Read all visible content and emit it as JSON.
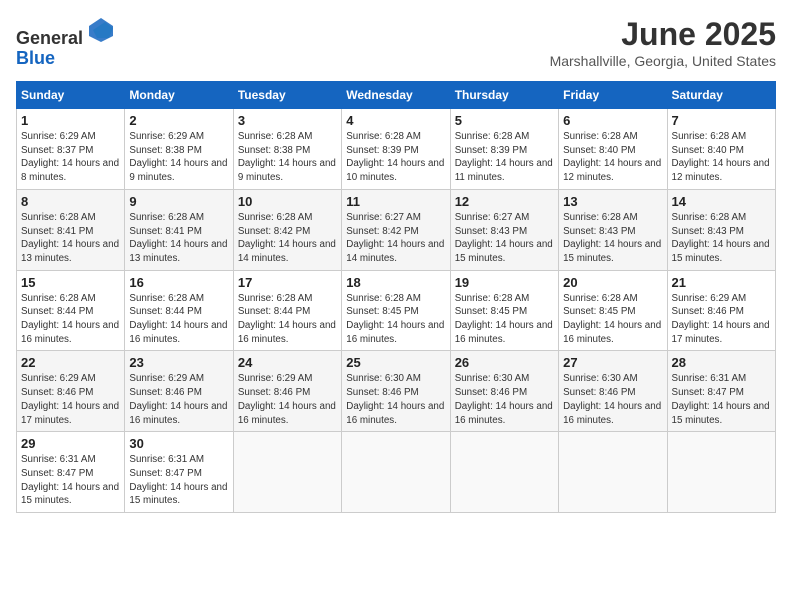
{
  "header": {
    "logo_line1": "General",
    "logo_line2": "Blue",
    "month_title": "June 2025",
    "location": "Marshallville, Georgia, United States"
  },
  "weekdays": [
    "Sunday",
    "Monday",
    "Tuesday",
    "Wednesday",
    "Thursday",
    "Friday",
    "Saturday"
  ],
  "weeks": [
    [
      {
        "day": "1",
        "sunrise": "Sunrise: 6:29 AM",
        "sunset": "Sunset: 8:37 PM",
        "daylight": "Daylight: 14 hours and 8 minutes."
      },
      {
        "day": "2",
        "sunrise": "Sunrise: 6:29 AM",
        "sunset": "Sunset: 8:38 PM",
        "daylight": "Daylight: 14 hours and 9 minutes."
      },
      {
        "day": "3",
        "sunrise": "Sunrise: 6:28 AM",
        "sunset": "Sunset: 8:38 PM",
        "daylight": "Daylight: 14 hours and 9 minutes."
      },
      {
        "day": "4",
        "sunrise": "Sunrise: 6:28 AM",
        "sunset": "Sunset: 8:39 PM",
        "daylight": "Daylight: 14 hours and 10 minutes."
      },
      {
        "day": "5",
        "sunrise": "Sunrise: 6:28 AM",
        "sunset": "Sunset: 8:39 PM",
        "daylight": "Daylight: 14 hours and 11 minutes."
      },
      {
        "day": "6",
        "sunrise": "Sunrise: 6:28 AM",
        "sunset": "Sunset: 8:40 PM",
        "daylight": "Daylight: 14 hours and 12 minutes."
      },
      {
        "day": "7",
        "sunrise": "Sunrise: 6:28 AM",
        "sunset": "Sunset: 8:40 PM",
        "daylight": "Daylight: 14 hours and 12 minutes."
      }
    ],
    [
      {
        "day": "8",
        "sunrise": "Sunrise: 6:28 AM",
        "sunset": "Sunset: 8:41 PM",
        "daylight": "Daylight: 14 hours and 13 minutes."
      },
      {
        "day": "9",
        "sunrise": "Sunrise: 6:28 AM",
        "sunset": "Sunset: 8:41 PM",
        "daylight": "Daylight: 14 hours and 13 minutes."
      },
      {
        "day": "10",
        "sunrise": "Sunrise: 6:28 AM",
        "sunset": "Sunset: 8:42 PM",
        "daylight": "Daylight: 14 hours and 14 minutes."
      },
      {
        "day": "11",
        "sunrise": "Sunrise: 6:27 AM",
        "sunset": "Sunset: 8:42 PM",
        "daylight": "Daylight: 14 hours and 14 minutes."
      },
      {
        "day": "12",
        "sunrise": "Sunrise: 6:27 AM",
        "sunset": "Sunset: 8:43 PM",
        "daylight": "Daylight: 14 hours and 15 minutes."
      },
      {
        "day": "13",
        "sunrise": "Sunrise: 6:28 AM",
        "sunset": "Sunset: 8:43 PM",
        "daylight": "Daylight: 14 hours and 15 minutes."
      },
      {
        "day": "14",
        "sunrise": "Sunrise: 6:28 AM",
        "sunset": "Sunset: 8:43 PM",
        "daylight": "Daylight: 14 hours and 15 minutes."
      }
    ],
    [
      {
        "day": "15",
        "sunrise": "Sunrise: 6:28 AM",
        "sunset": "Sunset: 8:44 PM",
        "daylight": "Daylight: 14 hours and 16 minutes."
      },
      {
        "day": "16",
        "sunrise": "Sunrise: 6:28 AM",
        "sunset": "Sunset: 8:44 PM",
        "daylight": "Daylight: 14 hours and 16 minutes."
      },
      {
        "day": "17",
        "sunrise": "Sunrise: 6:28 AM",
        "sunset": "Sunset: 8:44 PM",
        "daylight": "Daylight: 14 hours and 16 minutes."
      },
      {
        "day": "18",
        "sunrise": "Sunrise: 6:28 AM",
        "sunset": "Sunset: 8:45 PM",
        "daylight": "Daylight: 14 hours and 16 minutes."
      },
      {
        "day": "19",
        "sunrise": "Sunrise: 6:28 AM",
        "sunset": "Sunset: 8:45 PM",
        "daylight": "Daylight: 14 hours and 16 minutes."
      },
      {
        "day": "20",
        "sunrise": "Sunrise: 6:28 AM",
        "sunset": "Sunset: 8:45 PM",
        "daylight": "Daylight: 14 hours and 16 minutes."
      },
      {
        "day": "21",
        "sunrise": "Sunrise: 6:29 AM",
        "sunset": "Sunset: 8:46 PM",
        "daylight": "Daylight: 14 hours and 17 minutes."
      }
    ],
    [
      {
        "day": "22",
        "sunrise": "Sunrise: 6:29 AM",
        "sunset": "Sunset: 8:46 PM",
        "daylight": "Daylight: 14 hours and 17 minutes."
      },
      {
        "day": "23",
        "sunrise": "Sunrise: 6:29 AM",
        "sunset": "Sunset: 8:46 PM",
        "daylight": "Daylight: 14 hours and 16 minutes."
      },
      {
        "day": "24",
        "sunrise": "Sunrise: 6:29 AM",
        "sunset": "Sunset: 8:46 PM",
        "daylight": "Daylight: 14 hours and 16 minutes."
      },
      {
        "day": "25",
        "sunrise": "Sunrise: 6:30 AM",
        "sunset": "Sunset: 8:46 PM",
        "daylight": "Daylight: 14 hours and 16 minutes."
      },
      {
        "day": "26",
        "sunrise": "Sunrise: 6:30 AM",
        "sunset": "Sunset: 8:46 PM",
        "daylight": "Daylight: 14 hours and 16 minutes."
      },
      {
        "day": "27",
        "sunrise": "Sunrise: 6:30 AM",
        "sunset": "Sunset: 8:46 PM",
        "daylight": "Daylight: 14 hours and 16 minutes."
      },
      {
        "day": "28",
        "sunrise": "Sunrise: 6:31 AM",
        "sunset": "Sunset: 8:47 PM",
        "daylight": "Daylight: 14 hours and 15 minutes."
      }
    ],
    [
      {
        "day": "29",
        "sunrise": "Sunrise: 6:31 AM",
        "sunset": "Sunset: 8:47 PM",
        "daylight": "Daylight: 14 hours and 15 minutes."
      },
      {
        "day": "30",
        "sunrise": "Sunrise: 6:31 AM",
        "sunset": "Sunset: 8:47 PM",
        "daylight": "Daylight: 14 hours and 15 minutes."
      },
      null,
      null,
      null,
      null,
      null
    ]
  ]
}
